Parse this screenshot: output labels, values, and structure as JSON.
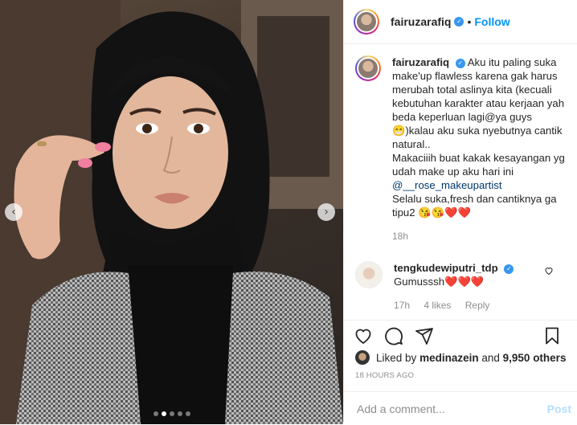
{
  "photo": {
    "alt_icon": "carousel-photo",
    "prev_icon": "chevron-left-icon",
    "next_icon": "chevron-right-icon",
    "prev_glyph": "‹",
    "next_glyph": "›",
    "dots_total": 5,
    "dots_active": 2
  },
  "header": {
    "username": "fairuzarafiq",
    "verified_glyph": "✓",
    "separator": "•",
    "follow_label": "Follow"
  },
  "caption": {
    "author": "fairuzarafiq",
    "lines": [
      "Aku itu paling suka",
      "make'up flawless karena gak harus",
      "merubah total aslinya kita (kecuali",
      "kebutuhan karakter atau kerjaan yah",
      "beda keperluan lagi@ya guys",
      "😁)kalau aku suka nyebutnya cantik",
      "natural..",
      "Makaciiih buat kakak kesayangan yg",
      "udah make up aku hari ini"
    ],
    "mention": "@__rose_makeupartist",
    "closing_lines": [
      "Selalu suka,fresh dan cantiknya ga",
      "tipu2 😘😘❤️❤️"
    ],
    "time": "18h"
  },
  "comment": {
    "author": "tengkudewiputri_tdp",
    "text": "Gumusssh",
    "hearts": "❤️❤️❤️",
    "time": "17h",
    "likes": "4 likes",
    "reply_label": "Reply"
  },
  "likes": {
    "prefix": "Liked by",
    "user": "medinazein",
    "and": "and",
    "others": "9,950 others"
  },
  "timestamp": "18 HOURS AGO",
  "add_comment": {
    "placeholder": "Add a comment...",
    "post_label": "Post"
  },
  "colors": {
    "accent": "#0095f6",
    "post_disabled": "#b2dffc",
    "meta": "#8e8e8e",
    "heart": "#ed1b24"
  }
}
